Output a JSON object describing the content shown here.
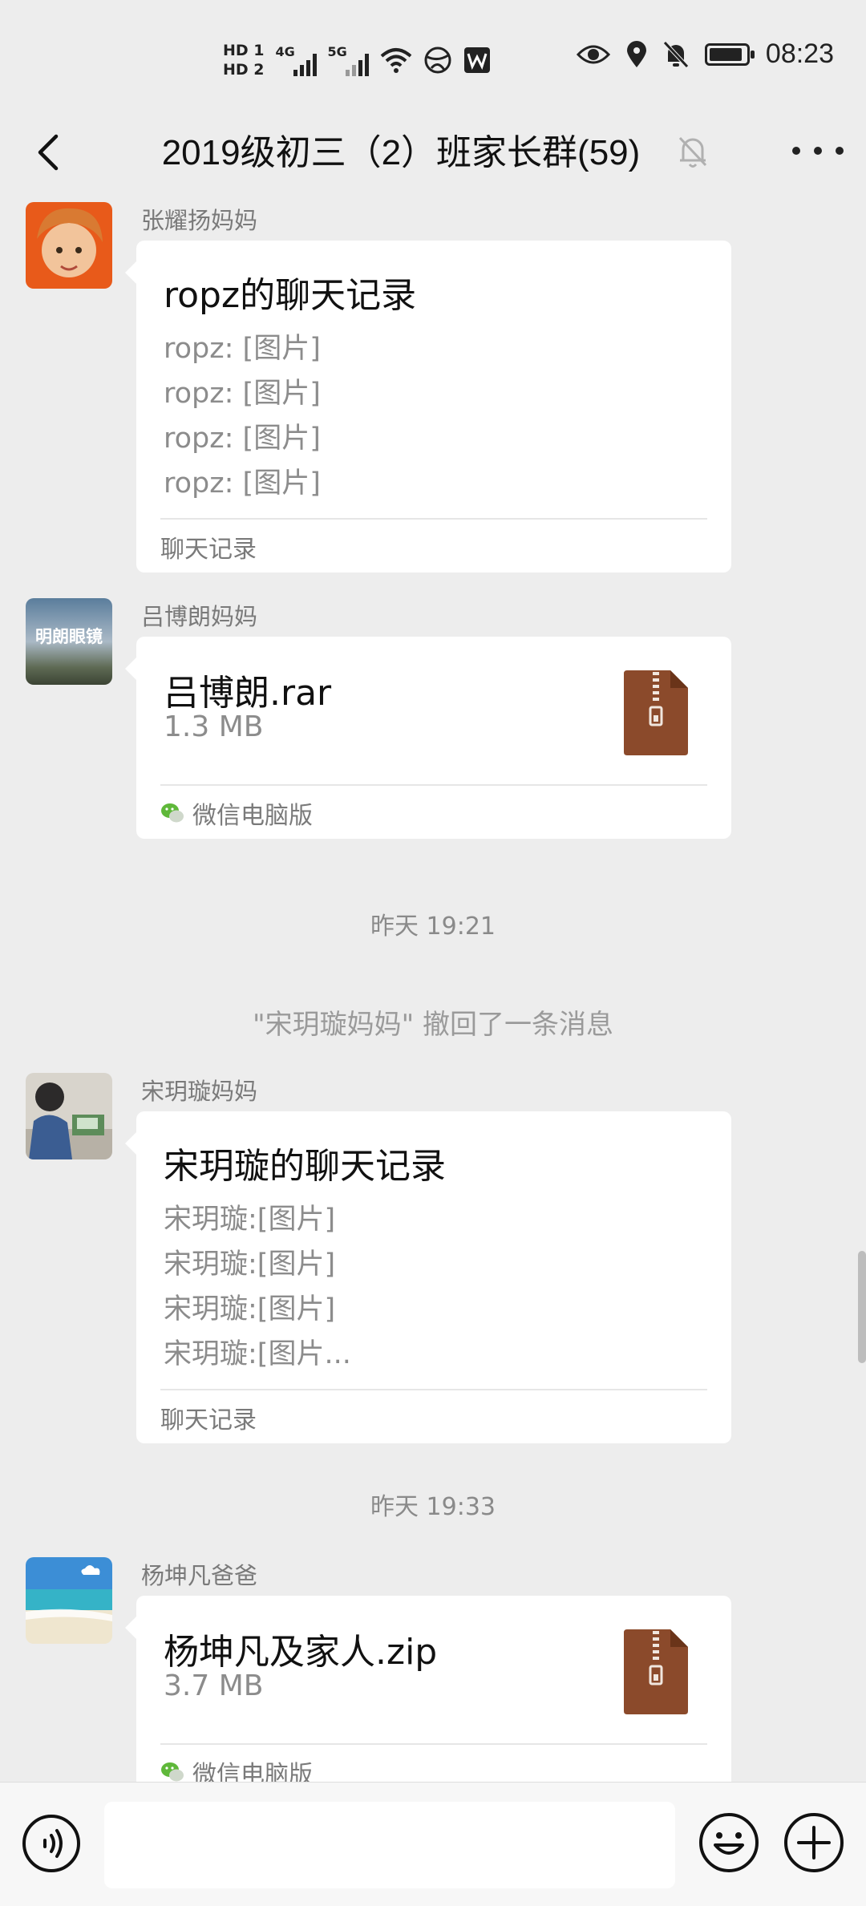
{
  "status_bar": {
    "sim1": "HD 1",
    "sim2": "HD 2",
    "net1": "4G",
    "net2": "5G",
    "time": "08:23",
    "icons": [
      "wifi-icon",
      "globe-icon",
      "wps-icon",
      "eye-icon",
      "location-icon",
      "bell-off-icon",
      "battery-icon"
    ],
    "battery_level": 0.9
  },
  "nav": {
    "title": "2019级初三（2）班家长群(59)",
    "icons": [
      "back-icon",
      "mute-bell-icon",
      "more-icon"
    ]
  },
  "messages": [
    {
      "sender": "张耀扬妈妈",
      "type": "chat-record",
      "title": "ropz的聊天记录",
      "lines": [
        "ropz: [图片]",
        "ropz: [图片]",
        "ropz: [图片]",
        "ropz: [图片]"
      ],
      "footer": "聊天记录"
    },
    {
      "sender": "吕博朗妈妈",
      "avatar_text": "明朗眼镜",
      "type": "file",
      "file_name": "吕博朗.rar",
      "file_size": "1.3 MB",
      "footer": "微信电脑版"
    },
    {
      "sender": "宋玥璇妈妈",
      "type": "chat-record",
      "title": "宋玥璇的聊天记录",
      "lines": [
        "宋玥璇:[图片]",
        "宋玥璇:[图片]",
        "宋玥璇:[图片]",
        "宋玥璇:[图片..."
      ],
      "footer": "聊天记录"
    },
    {
      "sender": "杨坤凡爸爸",
      "type": "file",
      "file_name": "杨坤凡及家人.zip",
      "file_size": "3.7 MB",
      "footer": "微信电脑版"
    }
  ],
  "timestamps": [
    "昨天 19:21",
    "昨天 19:33"
  ],
  "notice": "\"宋玥璇妈妈\" 撤回了一条消息",
  "input_bar": {
    "icons": [
      "voice-icon",
      "emoji-icon",
      "plus-icon"
    ],
    "text_value": ""
  },
  "colors": {
    "background": "#ededed",
    "bubble": "#ffffff",
    "zip_icon": "#8b4a2b",
    "wechat_green": "#5fb83a"
  }
}
